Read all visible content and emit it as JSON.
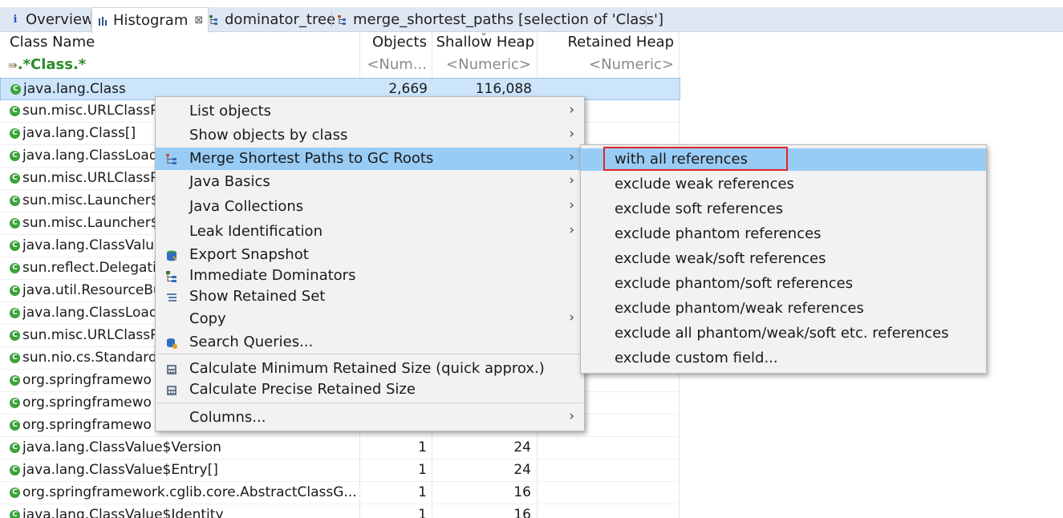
{
  "tabs": [
    {
      "label": "Overview",
      "icon": "info-icon"
    },
    {
      "label": "Histogram",
      "icon": "histogram-icon",
      "close": "⊠"
    },
    {
      "label": "dominator_tree",
      "icon": "tree-icon"
    },
    {
      "label": "merge_shortest_paths  [selection of 'Class']",
      "icon": "tree-icon"
    }
  ],
  "table": {
    "headers": {
      "class_name": "Class Name",
      "objects": "Objects",
      "shallow": "Shallow Heap",
      "retained": "Retained Heap"
    },
    "filter": {
      "class_name": ".*Class.*",
      "objects": "<Num...",
      "shallow": "<Numeric>",
      "retained": "<Numeric>"
    },
    "rows": [
      {
        "name": "java.lang.Class",
        "objects": "2,669",
        "shallow": "116,088"
      },
      {
        "name": "sun.misc.URLClassP",
        "objects": "",
        "shallow": ""
      },
      {
        "name": "java.lang.Class[]",
        "objects": "",
        "shallow": ""
      },
      {
        "name": "java.lang.ClassLoad",
        "objects": "",
        "shallow": ""
      },
      {
        "name": "sun.misc.URLClassP",
        "objects": "",
        "shallow": ""
      },
      {
        "name": "sun.misc.Launcher$",
        "objects": "",
        "shallow": ""
      },
      {
        "name": "sun.misc.Launcher$",
        "objects": "",
        "shallow": ""
      },
      {
        "name": "java.lang.ClassValue",
        "objects": "",
        "shallow": ""
      },
      {
        "name": "sun.reflect.Delegati",
        "objects": "",
        "shallow": ""
      },
      {
        "name": "java.util.ResourceBu",
        "objects": "",
        "shallow": ""
      },
      {
        "name": "java.lang.ClassLoad",
        "objects": "",
        "shallow": ""
      },
      {
        "name": "sun.misc.URLClassP",
        "objects": "",
        "shallow": ""
      },
      {
        "name": "sun.nio.cs.Standard",
        "objects": "",
        "shallow": ""
      },
      {
        "name": "org.springframewo",
        "objects": "",
        "shallow": ""
      },
      {
        "name": "org.springframewo",
        "objects": "",
        "shallow": ""
      },
      {
        "name": "org.springframewo",
        "objects": "",
        "shallow": ""
      },
      {
        "name": "java.lang.ClassValue$Version",
        "objects": "1",
        "shallow": "24"
      },
      {
        "name": "java.lang.ClassValue$Entry[]",
        "objects": "1",
        "shallow": "24"
      },
      {
        "name": "org.springframework.cglib.core.AbstractClassG...",
        "objects": "1",
        "shallow": "16"
      },
      {
        "name": "java.lang.ClassValue$Identity",
        "objects": "1",
        "shallow": "16"
      }
    ]
  },
  "context_menu": {
    "items": [
      {
        "label": "List objects",
        "submenu": true,
        "icon": ""
      },
      {
        "label": "Show objects by class",
        "submenu": true,
        "icon": ""
      },
      {
        "label": "Merge Shortest Paths to GC Roots",
        "submenu": true,
        "icon": "paths-icon",
        "highlighted": true
      },
      {
        "label": "Java Basics",
        "submenu": true,
        "icon": ""
      },
      {
        "label": "Java Collections",
        "submenu": true,
        "icon": ""
      },
      {
        "label": "Leak Identification",
        "submenu": true,
        "icon": ""
      },
      {
        "label": "Export Snapshot",
        "submenu": false,
        "icon": "export-snapshot-icon"
      },
      {
        "label": "Immediate Dominators",
        "submenu": false,
        "icon": "dominators-icon"
      },
      {
        "label": "Show Retained Set",
        "submenu": false,
        "icon": "retained-set-icon"
      },
      {
        "label": "Copy",
        "submenu": true,
        "icon": ""
      },
      {
        "label": "Search Queries...",
        "submenu": false,
        "icon": "search-queries-icon"
      },
      {
        "label": "Calculate Minimum Retained Size (quick approx.)",
        "submenu": false,
        "icon": "calculator-icon"
      },
      {
        "label": "Calculate Precise Retained Size",
        "submenu": false,
        "icon": "calculator-icon"
      },
      {
        "label": "Columns...",
        "submenu": true,
        "icon": ""
      }
    ],
    "arrow": "›"
  },
  "submenu": {
    "items": [
      {
        "label": "with all references",
        "highlighted": true
      },
      {
        "label": "exclude weak references"
      },
      {
        "label": "exclude soft references"
      },
      {
        "label": "exclude phantom references"
      },
      {
        "label": "exclude weak/soft references"
      },
      {
        "label": "exclude phantom/soft references"
      },
      {
        "label": "exclude phantom/weak references"
      },
      {
        "label": "exclude all phantom/weak/soft etc. references"
      },
      {
        "label": "exclude custom field..."
      }
    ]
  },
  "colors": {
    "highlight": "#99ccf5",
    "selection": "#cce5fb",
    "annotation": "#e0242a",
    "class_icon": "#3aa33a",
    "filter_text": "#2a8a2a"
  }
}
